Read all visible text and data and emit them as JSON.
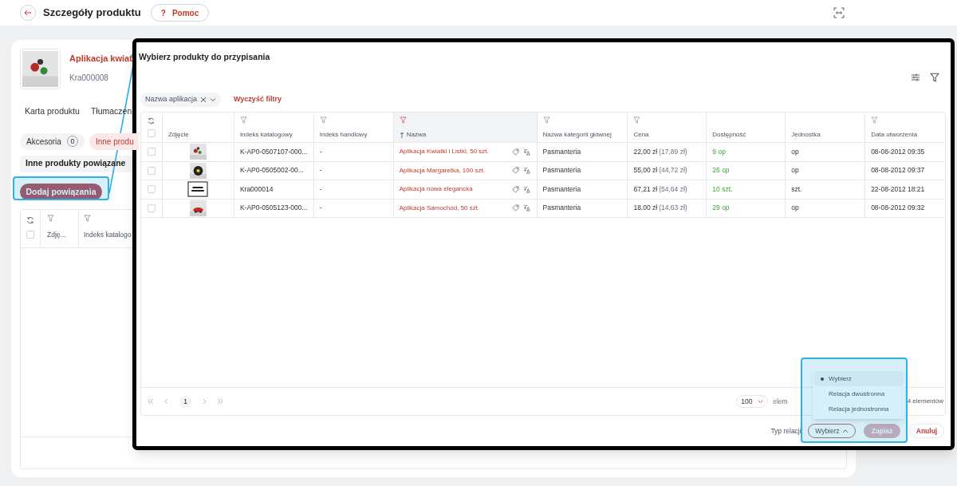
{
  "top_bar": {
    "title": "Szczegóły produktu",
    "help_button": {
      "icon": "?",
      "label": "Pomoc"
    }
  },
  "product": {
    "name": "Aplikacja kwiat",
    "code": "Kra000008"
  },
  "tabs": [
    {
      "label": "Karta produktu",
      "selected": false
    },
    {
      "label": "Tłumaczen",
      "selected": false
    }
  ],
  "chips": [
    {
      "label": "Akcesoria",
      "count": "0",
      "selected": false
    },
    {
      "label": "Inne produ",
      "selected": true
    }
  ],
  "section_title": "Inne produkty powiązane",
  "add_button": "Dodaj powiązania",
  "background_table": {
    "select_all_checked": false,
    "columns": [
      "Zdję...",
      "Indeks katalogo"
    ]
  },
  "modal": {
    "title": "Wybierz produkty do przypisania",
    "filter_chip": "Nazwa aplikacja",
    "clear_filters": "Wyczyść filtry",
    "columns": [
      {
        "label": "Zdjęcie",
        "filterable": false,
        "sorted": false
      },
      {
        "label": "Indeks katalogowy",
        "filterable": true,
        "filter_active": false,
        "sorted": false
      },
      {
        "label": "Indeks handlowy",
        "filterable": true,
        "filter_active": false,
        "sorted": false
      },
      {
        "label": "Nazwa",
        "filterable": true,
        "filter_active": true,
        "sorted": true
      },
      {
        "label": "Nazwa kategorii głównej",
        "filterable": true,
        "filter_active": false,
        "sorted": false
      },
      {
        "label": "Cena",
        "filterable": true,
        "filter_active": false,
        "sorted": false
      },
      {
        "label": "Dostępność",
        "filterable": false,
        "sorted": false
      },
      {
        "label": "Jednostka",
        "filterable": false,
        "sorted": false
      },
      {
        "label": "Data utworzenia",
        "filterable": true,
        "filter_active": false,
        "sorted": false
      }
    ],
    "select_all_checked": false,
    "rows": [
      {
        "checked": false,
        "catalog_index": "K-AP0-0507107-000...",
        "trade_index": "-",
        "name": "Aplikacja Kwiatki i Listki, 50 szt.",
        "category": "Pasmanteria",
        "price": "22,00 zł",
        "net_price": "(17,89 zł)",
        "availability": "9 op",
        "unit": "op",
        "created": "08-08-2012 09:35"
      },
      {
        "checked": false,
        "catalog_index": "K-AP0-0505002-00...",
        "trade_index": "-",
        "name": "Aplikacja Margaretka, 100 szt.",
        "category": "Pasmanteria",
        "price": "55,00 zł",
        "net_price": "(44,72 zł)",
        "availability": "26 op",
        "unit": "op",
        "created": "08-08-2012 09:37"
      },
      {
        "checked": false,
        "catalog_index": "Kra000014",
        "trade_index": "-",
        "name": "Aplikacja nowa elegancka",
        "category": "Pasmanteria",
        "price": "67,21 zł",
        "net_price": "(54,64 zł)",
        "availability": "10 szt.",
        "unit": "szt.",
        "created": "22-08-2012 18:21"
      },
      {
        "checked": false,
        "catalog_index": "K-AP0-0505123-000...",
        "trade_index": "-",
        "name": "Aplikacja Samochód, 50 szt.",
        "category": "Pasmanteria",
        "price": "18,00 zł",
        "net_price": "(14,63 zł)",
        "availability": "29 op",
        "unit": "op",
        "created": "08-08-2012 09:32"
      }
    ],
    "pagination": {
      "pages": [
        {
          "label": "1",
          "selected": true
        }
      ],
      "page_size": "100",
      "page_size_label": "elem",
      "total": "4 elementów"
    },
    "relation_label": "Typ relacji:",
    "relation_select": "Wybierz",
    "save_button": {
      "label": "Zapisz",
      "disabled": true
    },
    "cancel_button": "Anuluj",
    "dropdown": [
      {
        "label": "Wybierz",
        "selected": true
      },
      {
        "label": "Relacja dwustronna",
        "selected": false
      },
      {
        "label": "Relacja jednostronna",
        "selected": false
      }
    ]
  }
}
